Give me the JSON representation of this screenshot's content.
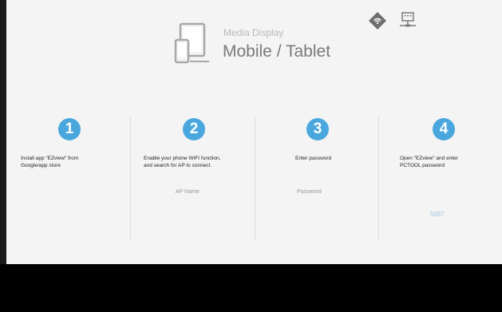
{
  "header": {
    "subtitle": "Media Display",
    "title": "Mobile / Tablet",
    "device_icon": "phone-tablet-icon"
  },
  "mode_icons": [
    {
      "icon": "wifi-diamond-icon"
    },
    {
      "icon": "lan-network-icon"
    }
  ],
  "steps": [
    {
      "number": "1",
      "instruction": "Install app \"EZview\" from\nGoogle/app store"
    },
    {
      "number": "2",
      "instruction": "Enable your phone WIFI function,\nand search for AP to connect.",
      "field_label": "AP Name"
    },
    {
      "number": "3",
      "instruction": "Enter password",
      "field_label": "Password"
    },
    {
      "number": "4",
      "instruction": "Open \"EZview\" and enter\nPCTOOL password",
      "pin": "5997"
    }
  ],
  "colors": {
    "accent": "#4aa7de",
    "background": "#f4f4f4",
    "pin": "#9ec3dc"
  }
}
